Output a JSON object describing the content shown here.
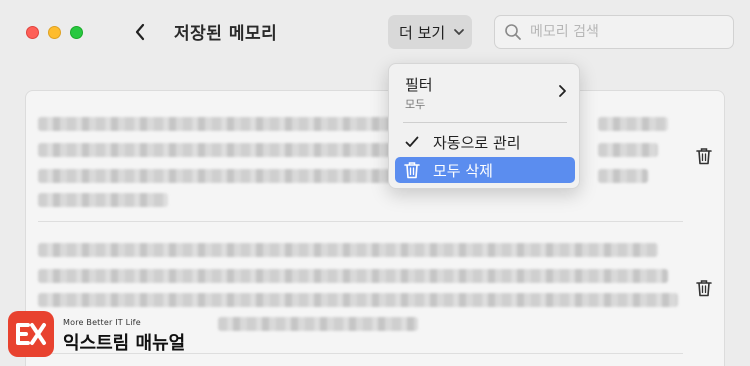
{
  "header": {
    "title": "저장된 메모리",
    "more_label": "더 보기",
    "search_placeholder": "메모리 검색"
  },
  "menu": {
    "filter_label": "필터",
    "filter_value": "모두",
    "auto_manage_label": "자동으로 관리",
    "delete_all_label": "모두 삭제"
  },
  "memories": [
    {
      "blurred": true
    },
    {
      "blurred": true
    }
  ],
  "watermark": {
    "tagline": "More Better IT Life",
    "brand": "익스트림 매뉴얼"
  },
  "colors": {
    "accent": "#5b8def",
    "close": "#fe5f57",
    "minimize": "#febc2e",
    "zoom": "#28c840",
    "brand": "#e8422f"
  }
}
